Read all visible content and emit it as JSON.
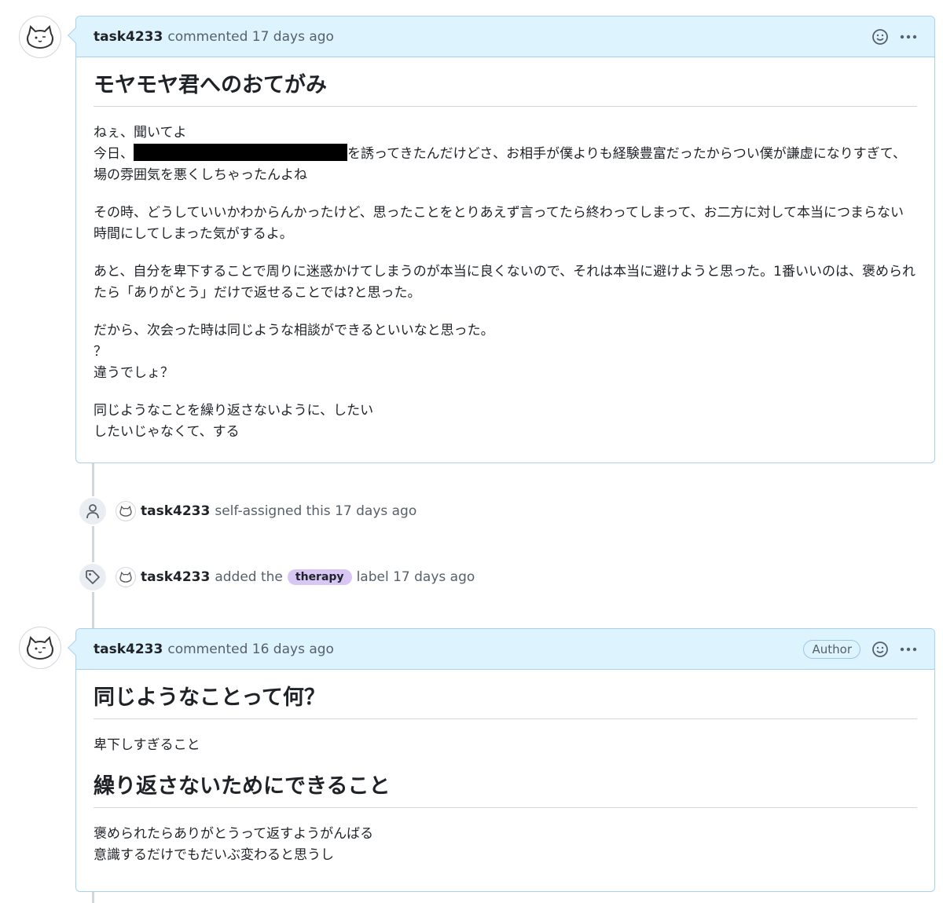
{
  "comment1": {
    "author": "task4233",
    "meta": "commented 17 days ago",
    "heading": "モヤモヤ君へのおてがみ",
    "paragraphs": [
      [
        "ねぇ、聞いてよ"
      ],
      [
        "今日、",
        "[REDACTED]",
        "を誘ってきたんだけどさ、お相手が僕よりも経験豊富だったからつい僕が謙虚になりすぎて、場の雰囲気を悪くしちゃったんよね"
      ],
      [
        "その時、どうしていいかわからんかったけど、思ったことをとりあえず言ってたら終わってしまって、お二方に対して本当につまらない時間にしてしまった気がするよ。"
      ],
      [
        "あと、自分を卑下することで周りに迷惑かけてしまうのが本当に良くないので、それは本当に避けようと思った。1番いいのは、褒められたら「ありがとう」だけで返せることでは?と思った。"
      ],
      [
        "だから、次会った時は同じような相談ができるといいなと思った。",
        "？",
        "違うでしょ？"
      ],
      [
        "同じようなことを繰り返さないように、したい",
        "したいじゃなくて、する"
      ]
    ]
  },
  "event_assigned": {
    "icon": "person-icon",
    "actor": "task4233",
    "text": "self-assigned this 17 days ago"
  },
  "event_labeled": {
    "icon": "tag-icon",
    "actor": "task4233",
    "text_before": "added the",
    "label": "therapy",
    "label_color": "#d8c6f5",
    "text_after": "label 17 days ago"
  },
  "comment2": {
    "author": "task4233",
    "meta": "commented 16 days ago",
    "badge": "Author",
    "heading1": "同じようなことって何？",
    "text1": "卑下しすぎること",
    "heading2": "繰り返さないためにできること",
    "text2_line1": "褒められたらありがとうって返すようがんばる",
    "text2_line2": "意識するだけでもだいぶ変わると思うし"
  }
}
